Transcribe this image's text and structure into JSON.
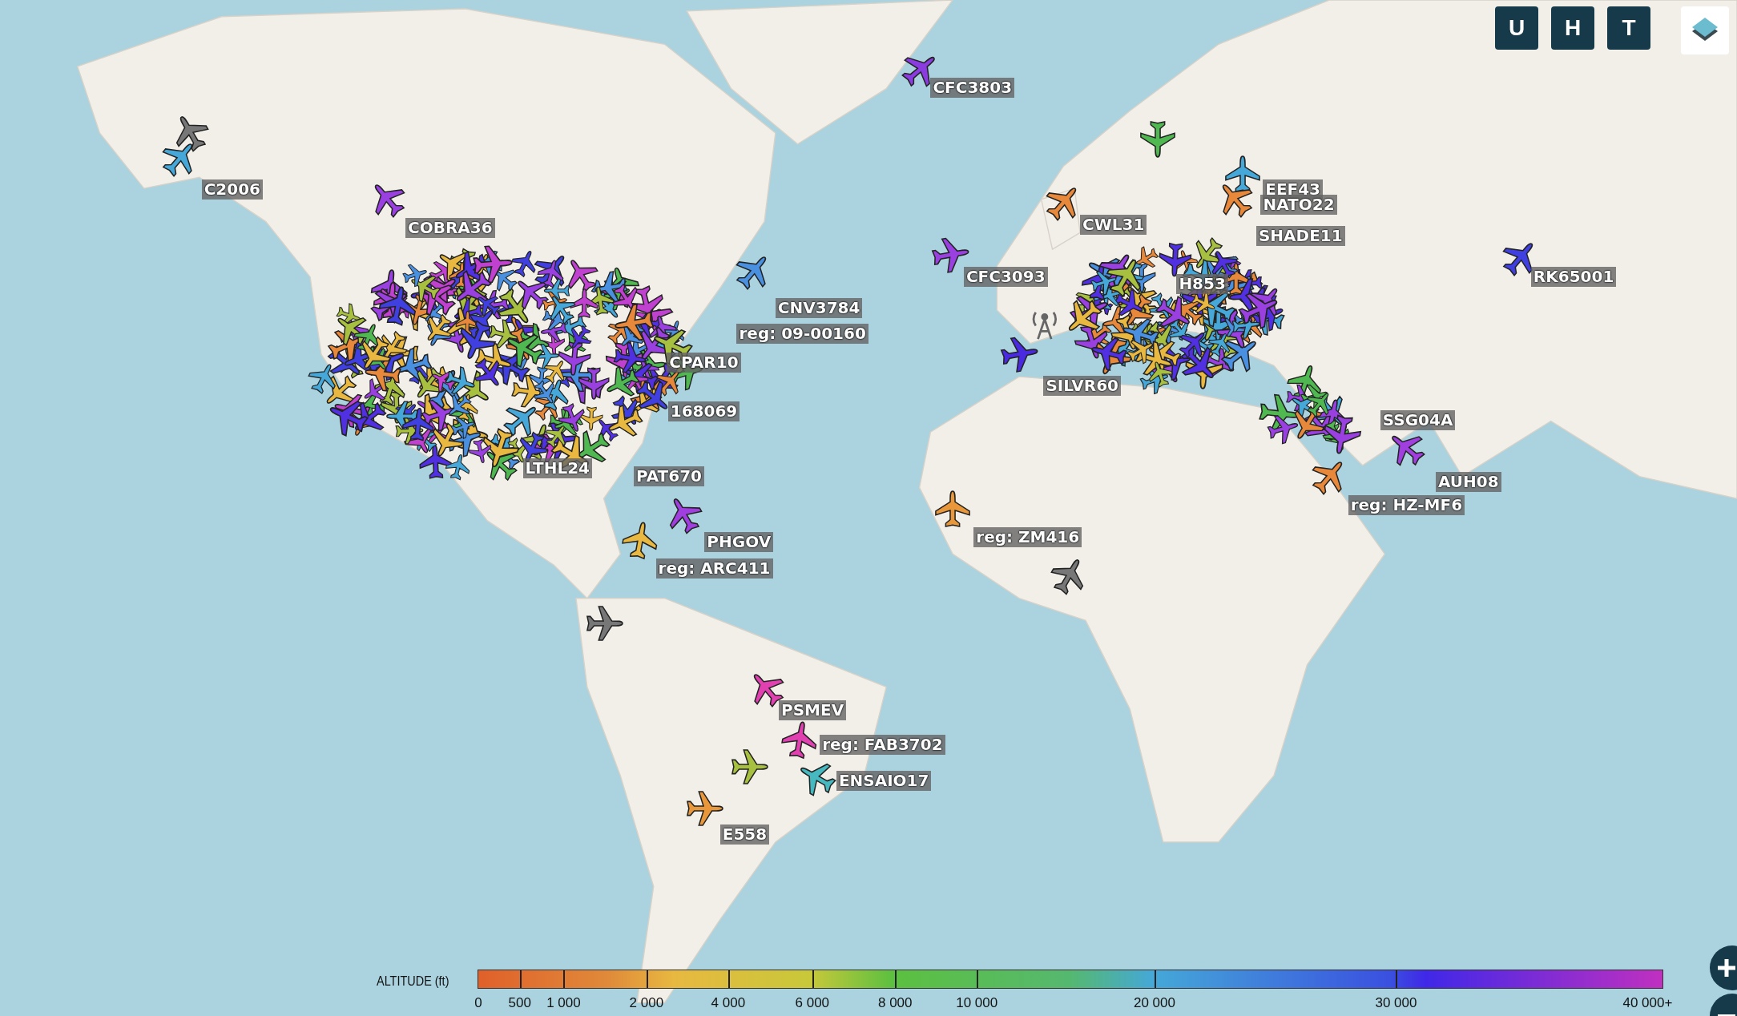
{
  "map_controls": {
    "buttons": [
      "U",
      "H",
      "T"
    ]
  },
  "aircraft": [
    {
      "label": "CFC3803",
      "color": "#8a3ce0"
    },
    {
      "color": "#777777"
    },
    {
      "color": "#50b850"
    },
    {
      "label": "C2006",
      "color": "#45a8d8"
    },
    {
      "label": "EEF43",
      "color": "#45a8d8"
    },
    {
      "label": "NATO22",
      "color": "#e8883a"
    },
    {
      "color": "#e8883a"
    },
    {
      "label": "CWL31"
    },
    {
      "label": "COBRA36",
      "color": "#9a40e0"
    },
    {
      "label": "SHADE11"
    },
    {
      "label": "CFC3093",
      "color": "#9a40e0"
    },
    {
      "label": "RK65001",
      "color": "#4040e0"
    },
    {
      "label": "H853"
    },
    {
      "label": "CNV3784",
      "color": "#4a90e0"
    },
    {
      "label": "reg: 09-00160"
    },
    {
      "label": "CPAR10"
    },
    {
      "label": "SILVR60",
      "color": "#4a2ae0"
    },
    {
      "label": "168069"
    },
    {
      "label": "SSG04A"
    },
    {
      "label": "LTHL24"
    },
    {
      "label": "PAT670"
    },
    {
      "label": "AUH08",
      "color": "#a03ee0"
    },
    {
      "label": "reg: HZ-MF6",
      "color": "#e8883a"
    },
    {
      "label": "reg: ZM416",
      "color": "#e8983a"
    },
    {
      "label": "PHGOV",
      "color": "#a03ee0"
    },
    {
      "label": "reg: ARC411",
      "color": "#e8b840"
    },
    {
      "color": "#777777"
    },
    {
      "color": "#777777"
    },
    {
      "label": "PSMEV",
      "color": "#e040b0"
    },
    {
      "label": "reg: FAB3702",
      "color": "#e040b0"
    },
    {
      "color": "#a8c040"
    },
    {
      "label": "ENSAIO17",
      "color": "#45b8c0"
    },
    {
      "label": "E558",
      "color": "#e8983a"
    }
  ],
  "altitude_legend": {
    "title": "ALTITUDE (ft)",
    "ticks": [
      "0",
      "500",
      "1 000",
      "2 000",
      "4 000",
      "6 000",
      "8 000",
      "10 000",
      "20 000",
      "30 000",
      "40 000+"
    ]
  }
}
